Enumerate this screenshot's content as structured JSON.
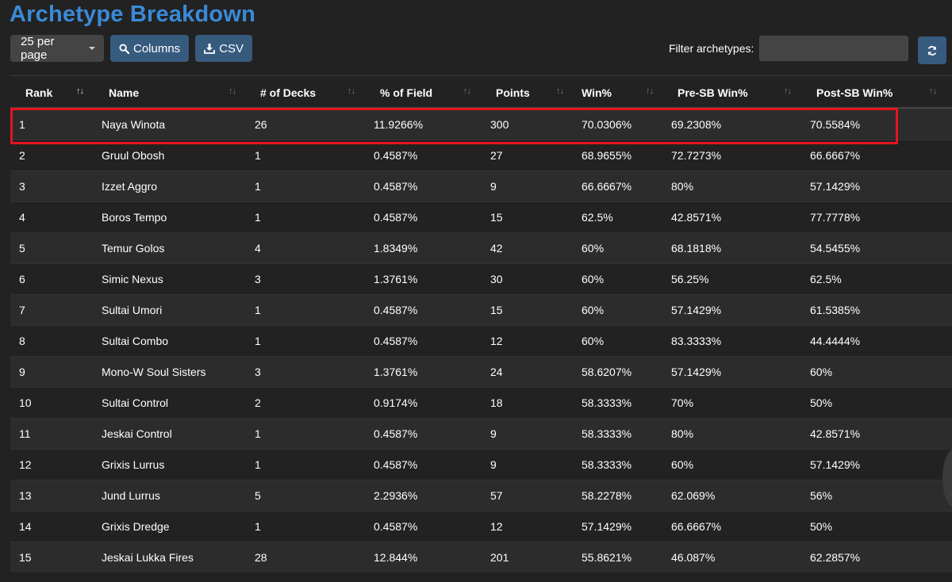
{
  "page_title": "Archetype Breakdown",
  "toolbar": {
    "per_page": "25 per page",
    "columns_label": "Columns",
    "csv_label": "CSV"
  },
  "filter": {
    "label": "Filter archetypes:",
    "value": "",
    "placeholder": ""
  },
  "colors": {
    "title": "#3a8ad8",
    "primary_button": "#375a7f",
    "highlight_border": "#e5141e",
    "background": "#222222"
  },
  "icons": {
    "columns": "search-icon",
    "csv": "download-icon",
    "refresh": "refresh-icon",
    "sort": "sort-arrows-icon"
  },
  "table": {
    "headers": [
      "Rank",
      "Name",
      "# of Decks",
      "% of Field",
      "Points",
      "Win%",
      "Pre-SB Win%",
      "Post-SB Win%"
    ],
    "rows": [
      [
        "1",
        "Naya Winota",
        "26",
        "11.9266%",
        "300",
        "70.0306%",
        "69.2308%",
        "70.5584%"
      ],
      [
        "2",
        "Gruul Obosh",
        "1",
        "0.4587%",
        "27",
        "68.9655%",
        "72.7273%",
        "66.6667%"
      ],
      [
        "3",
        "Izzet Aggro",
        "1",
        "0.4587%",
        "9",
        "66.6667%",
        "80%",
        "57.1429%"
      ],
      [
        "4",
        "Boros Tempo",
        "1",
        "0.4587%",
        "15",
        "62.5%",
        "42.8571%",
        "77.7778%"
      ],
      [
        "5",
        "Temur Golos",
        "4",
        "1.8349%",
        "42",
        "60%",
        "68.1818%",
        "54.5455%"
      ],
      [
        "6",
        "Simic Nexus",
        "3",
        "1.3761%",
        "30",
        "60%",
        "56.25%",
        "62.5%"
      ],
      [
        "7",
        "Sultai Umori",
        "1",
        "0.4587%",
        "15",
        "60%",
        "57.1429%",
        "61.5385%"
      ],
      [
        "8",
        "Sultai Combo",
        "1",
        "0.4587%",
        "12",
        "60%",
        "83.3333%",
        "44.4444%"
      ],
      [
        "9",
        "Mono-W Soul Sisters",
        "3",
        "1.3761%",
        "24",
        "58.6207%",
        "57.1429%",
        "60%"
      ],
      [
        "10",
        "Sultai Control",
        "2",
        "0.9174%",
        "18",
        "58.3333%",
        "70%",
        "50%"
      ],
      [
        "11",
        "Jeskai Control",
        "1",
        "0.4587%",
        "9",
        "58.3333%",
        "80%",
        "42.8571%"
      ],
      [
        "12",
        "Grixis Lurrus",
        "1",
        "0.4587%",
        "9",
        "58.3333%",
        "60%",
        "57.1429%"
      ],
      [
        "13",
        "Jund Lurrus",
        "5",
        "2.2936%",
        "57",
        "58.2278%",
        "62.069%",
        "56%"
      ],
      [
        "14",
        "Grixis Dredge",
        "1",
        "0.4587%",
        "12",
        "57.1429%",
        "66.6667%",
        "50%"
      ],
      [
        "15",
        "Jeskai Lukka Fires",
        "28",
        "12.844%",
        "201",
        "55.8621%",
        "46.087%",
        "62.2857%"
      ]
    ]
  }
}
